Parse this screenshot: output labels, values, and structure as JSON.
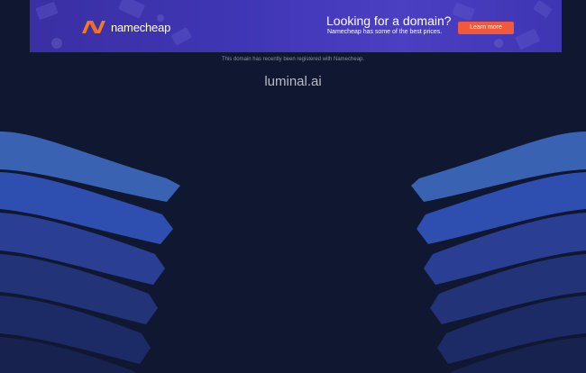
{
  "banner": {
    "logo_text": "namecheap",
    "headline": "Looking for a domain?",
    "subtext": "Namecheap has some of the best prices.",
    "cta_label": "Learn more",
    "colors": {
      "background": "#3f36b5",
      "cta": "#f0593a",
      "logo_orange": "#f7791d"
    }
  },
  "main": {
    "registered_note": "This domain has recently been registered with Namecheap.",
    "domain": "luminal.ai"
  },
  "colors": {
    "page_background": "#0f1830",
    "wave_colors": [
      "#3a62b3",
      "#2f4fb0",
      "#2a3f94",
      "#223378",
      "#1c2a66",
      "#17224f"
    ]
  },
  "icons": {
    "logo": "namecheap-n-icon"
  }
}
